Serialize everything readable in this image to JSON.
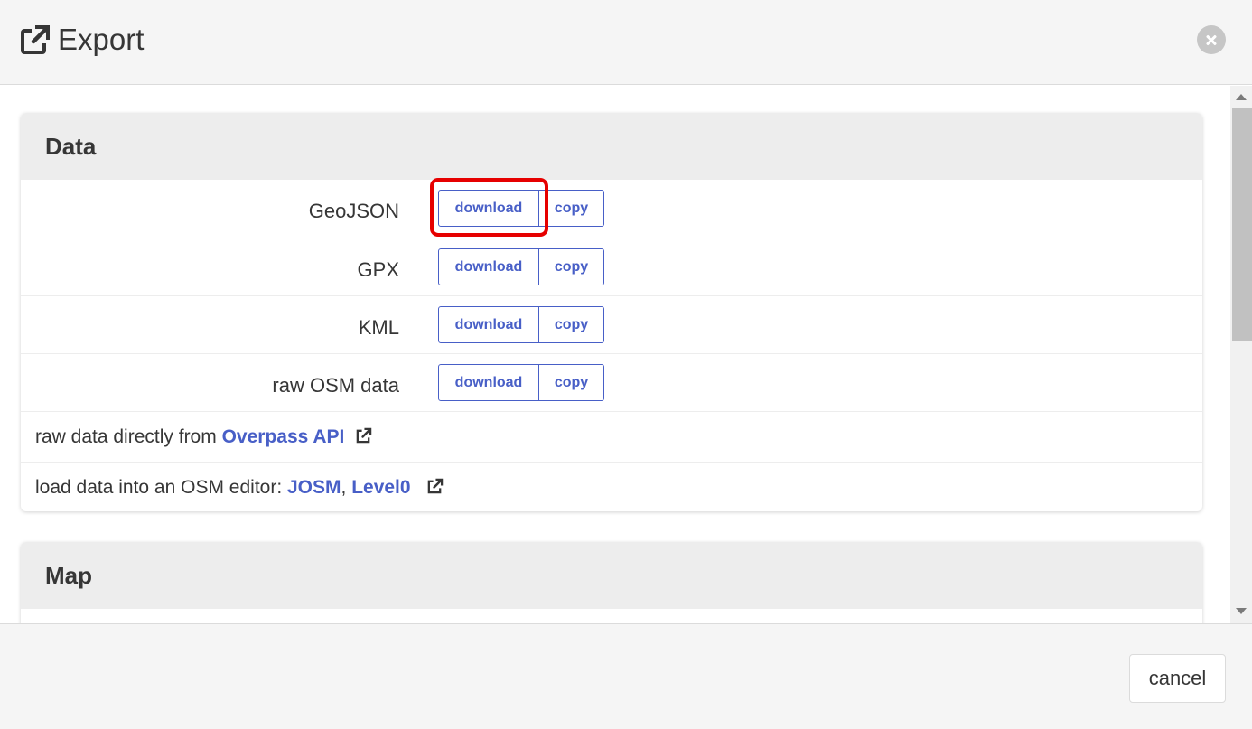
{
  "dialog": {
    "title": "Export",
    "title_icon": "external-link-icon",
    "close_icon": "close-icon"
  },
  "data_panel": {
    "heading": "Data",
    "formats": [
      {
        "label": "GeoJSON",
        "download": "download",
        "copy": "copy"
      },
      {
        "label": "GPX",
        "download": "download",
        "copy": "copy"
      },
      {
        "label": "KML",
        "download": "download",
        "copy": "copy"
      },
      {
        "label": "raw OSM data",
        "download": "download",
        "copy": "copy"
      }
    ],
    "overpass": {
      "prefix": "raw data directly from ",
      "link": "Overpass API"
    },
    "editor": {
      "prefix": "load data into an OSM editor: ",
      "josm": "JOSM",
      "sep": ", ",
      "level0": "Level0"
    }
  },
  "map_panel": {
    "heading": "Map"
  },
  "footer": {
    "cancel_label": "cancel"
  },
  "colors": {
    "link": "#485fc7",
    "highlight": "#e60000",
    "header_bg": "#f5f5f5",
    "panel_heading_bg": "#ededed"
  }
}
